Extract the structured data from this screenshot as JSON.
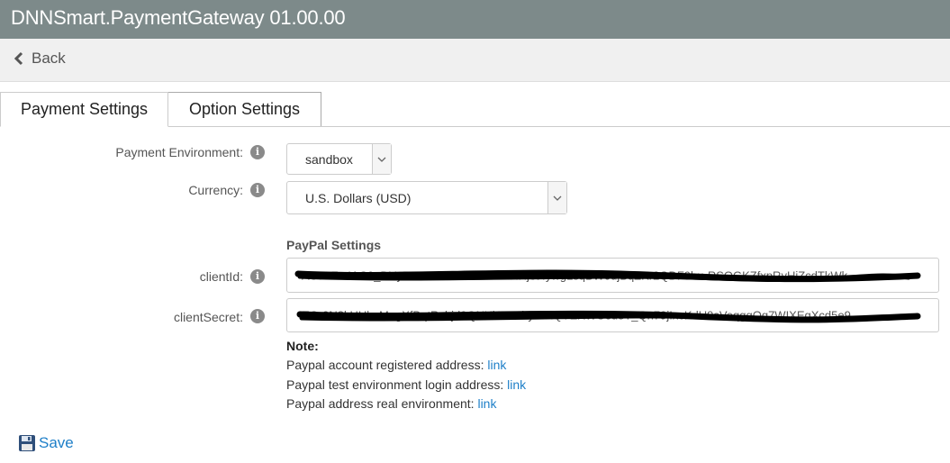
{
  "window": {
    "title": "DNNSmart.PaymentGateway 01.00.00"
  },
  "nav": {
    "back_label": "Back"
  },
  "tabs": [
    {
      "label": "Payment Settings"
    },
    {
      "label": "Option Settings"
    }
  ],
  "form": {
    "environment": {
      "label": "Payment Environment:",
      "value": "sandbox"
    },
    "currency": {
      "label": "Currency:",
      "value": "U.S. Dollars (USD)"
    },
    "paypal_section": "PayPal Settings",
    "client_id": {
      "label": "clientId:",
      "value": "AU7uFx-IAC0_DYyDSXvEsG21iYKbmTRHjet4ywgLsqBW0ujBqZKr2QDF9bu-RSOGKZfxpRyHjZcdTkWk"
    },
    "client_secret": {
      "label": "clientSecret:",
      "value": "EO-0N8kHHkeMegXfBqtRshjd9QNXkVembyAIXQYEXWC6u8T_Qn79jIxcKdU9sVeqggOq7WIXEgXcd5e9"
    }
  },
  "note": {
    "title": "Note:",
    "lines": [
      {
        "text": "Paypal account registered address: ",
        "link": "link"
      },
      {
        "text": "Paypal test environment login address: ",
        "link": "link"
      },
      {
        "text": "Paypal address real environment: ",
        "link": "link"
      }
    ]
  },
  "actions": {
    "save_label": "Save"
  },
  "colors": {
    "titlebar": "#7d8a8a",
    "link": "#1e7fc8"
  }
}
